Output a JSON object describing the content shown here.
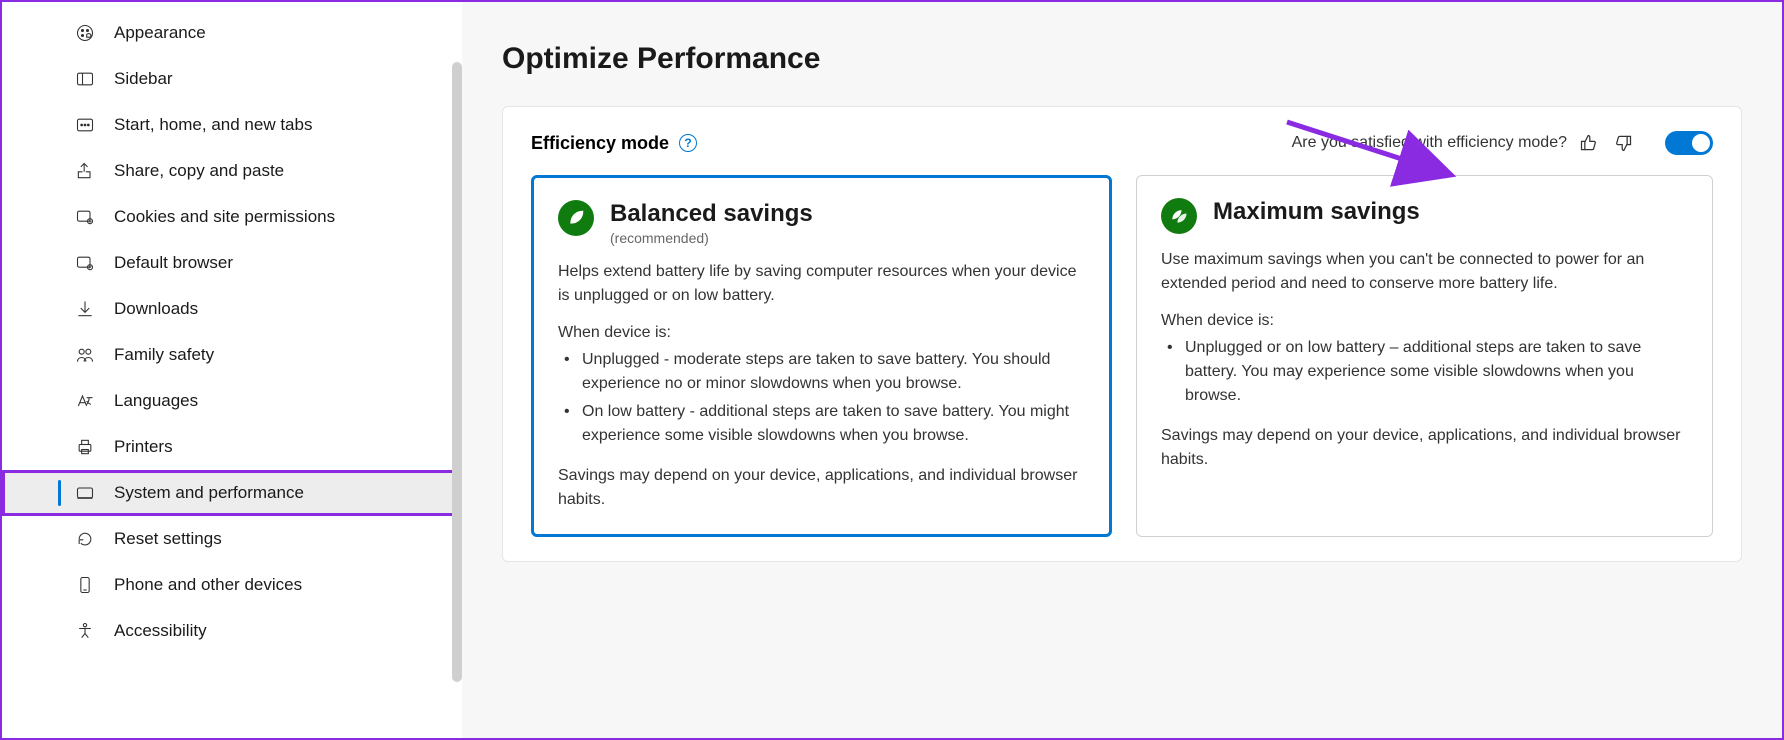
{
  "sidebar": {
    "items": [
      {
        "label": "Appearance"
      },
      {
        "label": "Sidebar"
      },
      {
        "label": "Start, home, and new tabs"
      },
      {
        "label": "Share, copy and paste"
      },
      {
        "label": "Cookies and site permissions"
      },
      {
        "label": "Default browser"
      },
      {
        "label": "Downloads"
      },
      {
        "label": "Family safety"
      },
      {
        "label": "Languages"
      },
      {
        "label": "Printers"
      },
      {
        "label": "System and performance"
      },
      {
        "label": "Reset settings"
      },
      {
        "label": "Phone and other devices"
      },
      {
        "label": "Accessibility"
      }
    ]
  },
  "main": {
    "section_title": "Optimize Performance",
    "efficiency": {
      "title": "Efficiency mode",
      "feedback_prompt": "Are you satisfied with efficiency mode?",
      "toggle_on": true,
      "balanced": {
        "title": "Balanced savings",
        "subtitle": "(recommended)",
        "description": "Helps extend battery life by saving computer resources when your device is unplugged or on low battery.",
        "when_label": "When device is:",
        "bullets": [
          "Unplugged - moderate steps are taken to save battery. You should experience no or minor slowdowns when you browse.",
          "On low battery - additional steps are taken to save battery. You might experience some visible slowdowns when you browse."
        ],
        "footer": "Savings may depend on your device, applications, and individual browser habits."
      },
      "maximum": {
        "title": "Maximum savings",
        "description": "Use maximum savings when you can't be connected to power for an extended period and need to conserve more battery life.",
        "when_label": "When device is:",
        "bullets": [
          "Unplugged or on low battery – additional steps are taken to save battery. You may experience some visible slowdowns when you browse."
        ],
        "footer": "Savings may depend on your device, applications, and individual browser habits."
      }
    }
  }
}
